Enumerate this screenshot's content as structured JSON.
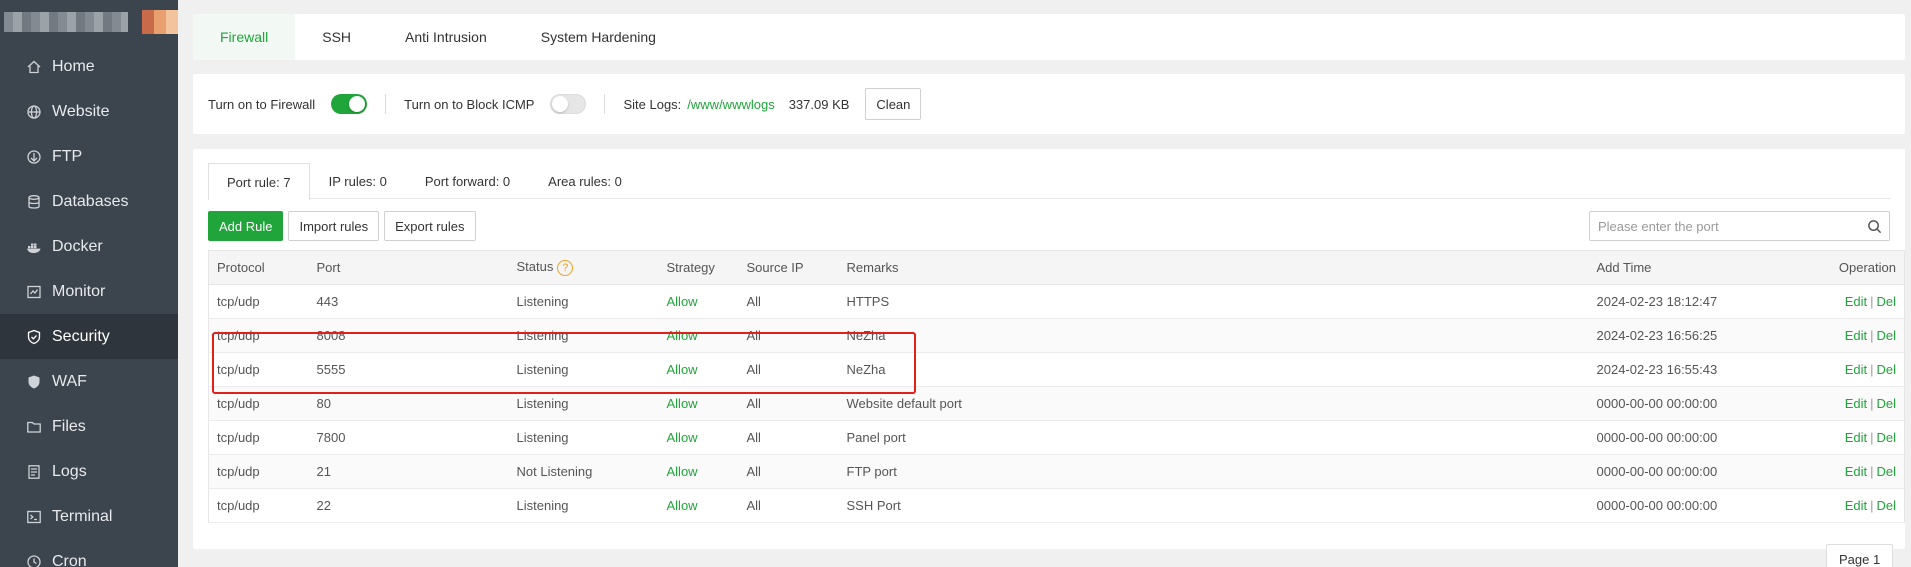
{
  "sidebar": {
    "items": [
      {
        "label": "Home",
        "icon": "home-icon"
      },
      {
        "label": "Website",
        "icon": "globe-icon"
      },
      {
        "label": "FTP",
        "icon": "ftp-icon"
      },
      {
        "label": "Databases",
        "icon": "database-icon"
      },
      {
        "label": "Docker",
        "icon": "docker-icon"
      },
      {
        "label": "Monitor",
        "icon": "monitor-icon"
      },
      {
        "label": "Security",
        "icon": "shield-icon",
        "active": true
      },
      {
        "label": "WAF",
        "icon": "waf-shield-icon"
      },
      {
        "label": "Files",
        "icon": "folder-icon"
      },
      {
        "label": "Logs",
        "icon": "logs-icon"
      },
      {
        "label": "Terminal",
        "icon": "terminal-icon"
      },
      {
        "label": "Cron",
        "icon": "clock-icon"
      }
    ]
  },
  "top_tabs": [
    "Firewall",
    "SSH",
    "Anti Intrusion",
    "System Hardening"
  ],
  "settings": {
    "firewall_label": "Turn on to Firewall",
    "firewall_on": true,
    "icmp_label": "Turn on to Block ICMP",
    "icmp_on": false,
    "site_logs_label": "Site Logs:",
    "site_logs_path": "/www/wwwlogs",
    "site_logs_size": "337.09 KB",
    "clean_label": "Clean"
  },
  "sub_tabs": [
    "Port rule: 7",
    "IP rules: 0",
    "Port forward: 0",
    "Area rules: 0"
  ],
  "toolbar": {
    "add_rule": "Add Rule",
    "import_rules": "Import rules",
    "export_rules": "Export rules",
    "search_placeholder": "Please enter the port"
  },
  "table": {
    "headers": {
      "protocol": "Protocol",
      "port": "Port",
      "status": "Status",
      "strategy": "Strategy",
      "source_ip": "Source IP",
      "remarks": "Remarks",
      "add_time": "Add Time",
      "operation": "Operation"
    },
    "help_glyph": "?",
    "edit_label": "Edit",
    "separator": "|",
    "del_label": "Del",
    "rows": [
      {
        "protocol": "tcp/udp",
        "port": "443",
        "status": "Listening",
        "strategy": "Allow",
        "source_ip": "All",
        "remarks": "HTTPS",
        "add_time": "2024-02-23 18:12:47"
      },
      {
        "protocol": "tcp/udp",
        "port": "8008",
        "status": "Listening",
        "strategy": "Allow",
        "source_ip": "All",
        "remarks": "NeZha",
        "add_time": "2024-02-23 16:56:25"
      },
      {
        "protocol": "tcp/udp",
        "port": "5555",
        "status": "Listening",
        "strategy": "Allow",
        "source_ip": "All",
        "remarks": "NeZha",
        "add_time": "2024-02-23 16:55:43"
      },
      {
        "protocol": "tcp/udp",
        "port": "80",
        "status": "Listening",
        "strategy": "Allow",
        "source_ip": "All",
        "remarks": "Website default port",
        "add_time": "0000-00-00 00:00:00"
      },
      {
        "protocol": "tcp/udp",
        "port": "7800",
        "status": "Listening",
        "strategy": "Allow",
        "source_ip": "All",
        "remarks": "Panel port",
        "add_time": "0000-00-00 00:00:00"
      },
      {
        "protocol": "tcp/udp",
        "port": "21",
        "status": "Not Listening",
        "strategy": "Allow",
        "source_ip": "All",
        "remarks": "FTP port",
        "add_time": "0000-00-00 00:00:00"
      },
      {
        "protocol": "tcp/udp",
        "port": "22",
        "status": "Listening",
        "strategy": "Allow",
        "source_ip": "All",
        "remarks": "SSH Port",
        "add_time": "0000-00-00 00:00:00"
      }
    ]
  },
  "pager": {
    "label": "Page 1"
  },
  "colors": {
    "accent": "#20a53a",
    "sidebar_bg": "#3c444d",
    "highlight": "#e0201a",
    "help": "#f0a020"
  }
}
